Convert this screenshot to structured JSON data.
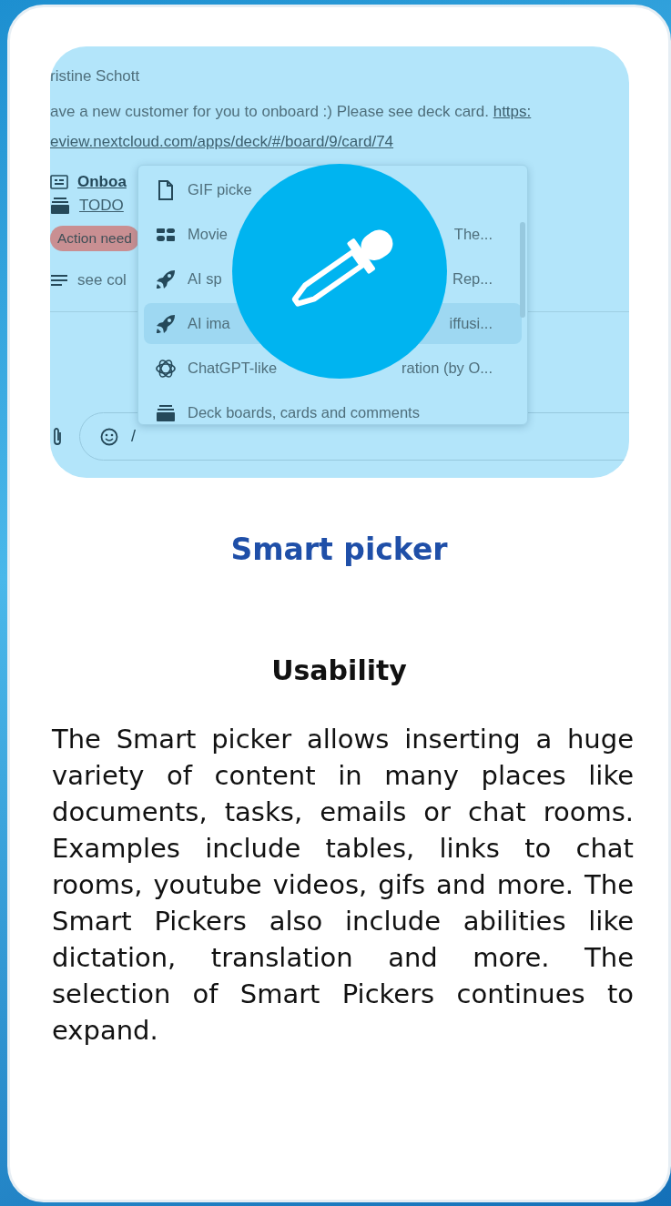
{
  "screenshot": {
    "author": "ristine Schott",
    "message": {
      "text": "ave a new customer for you to onboard :) Please see deck card.",
      "link_parts": [
        "https:",
        "eview.nextcloud.com/apps/deck/#/board/9/card/74"
      ]
    },
    "card_preview": {
      "title": "Onboa",
      "list": "TODO",
      "label": "Action need",
      "description": "see col"
    },
    "picker_menu": {
      "items": [
        {
          "kind": "file",
          "left": "GIF picke",
          "selected": false
        },
        {
          "kind": "movie",
          "left": "Movie",
          "right": "The...",
          "selected": false
        },
        {
          "kind": "rocket",
          "left": "AI sp",
          "right": "Rep...",
          "selected": false
        },
        {
          "kind": "rocket",
          "left": "AI ima",
          "right": "iffusi...",
          "selected": true
        },
        {
          "kind": "knot",
          "left": "ChatGPT-like",
          "right": "ration (by O...",
          "selected": false
        },
        {
          "kind": "stack",
          "left": "Deck boards, cards and comments",
          "selected": false
        }
      ]
    },
    "composer": {
      "value": "/"
    }
  },
  "title": "Smart picker",
  "section": "Usability",
  "body": "The Smart picker allows inserting a huge variety of content in many places like documents, tasks, emails or chat rooms. Examples include tables, links to chat rooms, youtube videos, gifs and more. The Smart Pickers also include abilities like dictation, translation and more. The selection of Smart Pickers continues to expand."
}
